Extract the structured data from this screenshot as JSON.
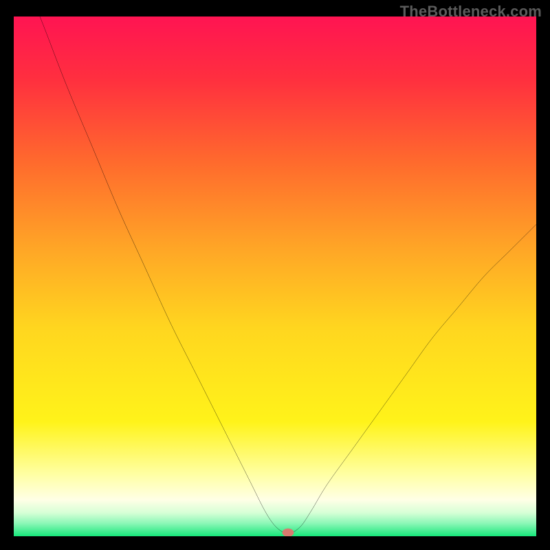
{
  "watermark": "TheBottleneck.com",
  "chart_data": {
    "type": "line",
    "title": "",
    "xlabel": "",
    "ylabel": "",
    "xlim": [
      0,
      100
    ],
    "ylim": [
      0,
      100
    ],
    "background": {
      "type": "vertical-gradient",
      "stops": [
        {
          "pos": 0.0,
          "color": "#ff1452"
        },
        {
          "pos": 0.12,
          "color": "#ff2f3f"
        },
        {
          "pos": 0.28,
          "color": "#ff6a2d"
        },
        {
          "pos": 0.45,
          "color": "#ffa726"
        },
        {
          "pos": 0.6,
          "color": "#ffd61f"
        },
        {
          "pos": 0.78,
          "color": "#fff31a"
        },
        {
          "pos": 0.88,
          "color": "#ffffa2"
        },
        {
          "pos": 0.93,
          "color": "#ffffe6"
        },
        {
          "pos": 0.955,
          "color": "#d6ffd6"
        },
        {
          "pos": 0.975,
          "color": "#8cf7b7"
        },
        {
          "pos": 1.0,
          "color": "#17e77a"
        }
      ]
    },
    "series": [
      {
        "name": "bottleneck-curve",
        "color": "#000000",
        "x": [
          0,
          5,
          10,
          15,
          20,
          25,
          30,
          35,
          40,
          45,
          48,
          50,
          52,
          53,
          55,
          57,
          60,
          65,
          70,
          75,
          80,
          85,
          90,
          95,
          100
        ],
        "values": [
          112,
          100,
          87,
          75,
          63,
          52,
          41,
          31,
          21,
          11,
          5,
          2,
          0.5,
          0.5,
          2,
          5,
          10,
          17,
          24,
          31,
          38,
          44,
          50,
          55,
          60
        ]
      }
    ],
    "marker": {
      "name": "optimal-point",
      "x": 52.5,
      "y": 0.7,
      "color": "#d87a6f",
      "rx": 1.1,
      "ry": 0.8
    }
  }
}
